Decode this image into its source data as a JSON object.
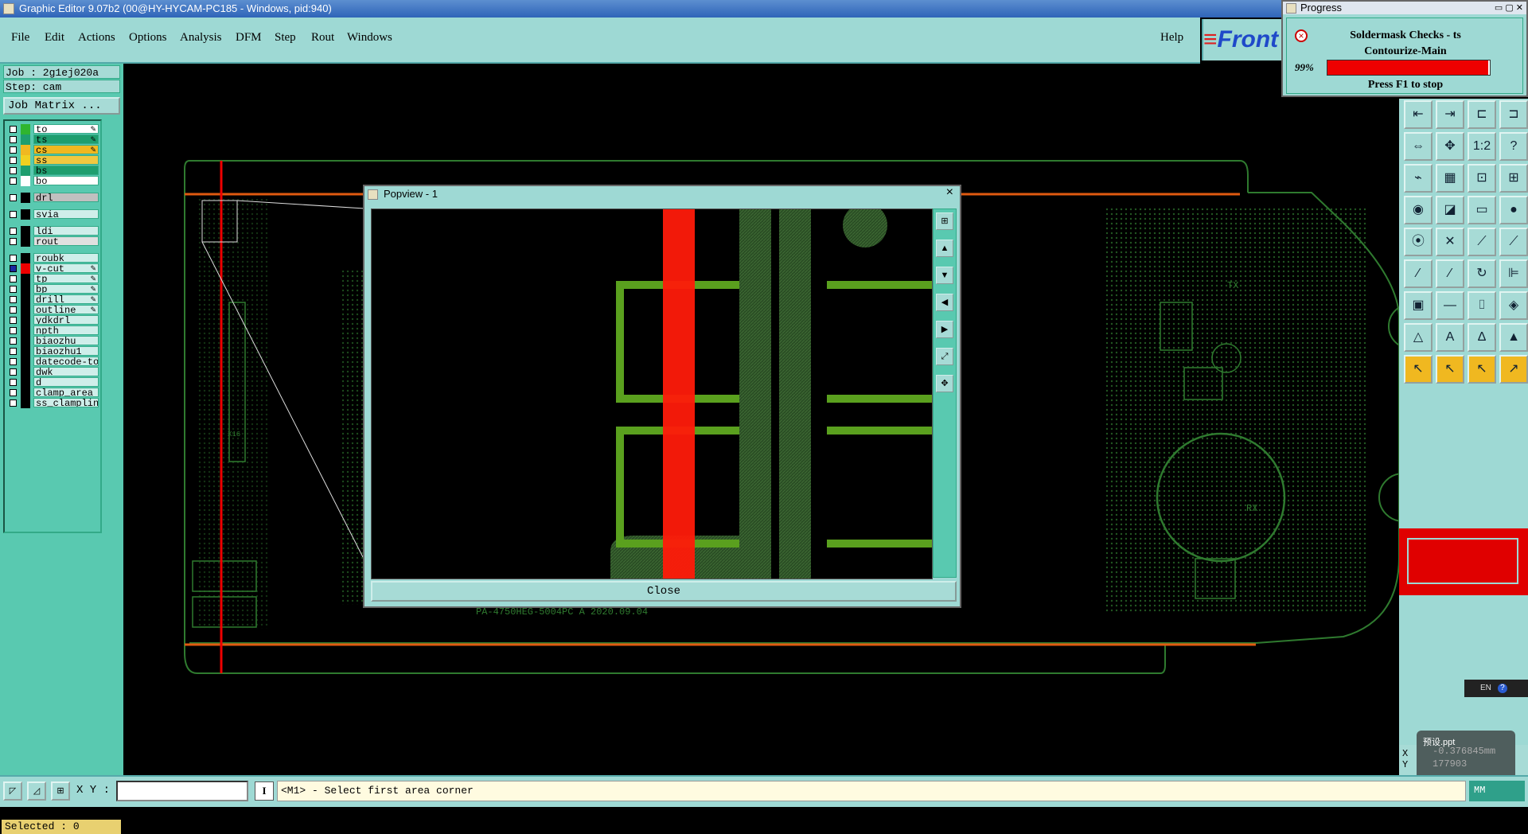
{
  "window": {
    "title": "Graphic Editor 9.07b2 (00@HY-HYCAM-PC185 - Windows, pid:940)"
  },
  "menu": {
    "items": [
      "File",
      "Edit",
      "Actions",
      "Options",
      "Analysis",
      "DFM",
      "Step",
      "Rout",
      "Windows"
    ],
    "help": "Help"
  },
  "logo": {
    "text": "Front"
  },
  "job": {
    "job_label": "Job : 2g1ej020a",
    "step_label": "Step: cam",
    "matrix_button": "Job Matrix ..."
  },
  "layers": [
    {
      "name": "to",
      "color": "#2fb52f",
      "name_bg": "#ffffff",
      "checked": false,
      "edit": true
    },
    {
      "name": "ts",
      "color": "#1e9e6e",
      "name_bg": "#1e9e6e",
      "checked": false,
      "edit": true
    },
    {
      "name": "cs",
      "color": "#f0b820",
      "name_bg": "#f0b820",
      "checked": false,
      "edit": true
    },
    {
      "name": "ss",
      "color": "#f0d020",
      "name_bg": "#f0c840",
      "checked": false,
      "edit": false
    },
    {
      "name": "bs",
      "color": "#1e9e6e",
      "name_bg": "#1e9e6e",
      "checked": false,
      "edit": false
    },
    {
      "name": "bo",
      "color": "#ffffff",
      "name_bg": "#ffffff",
      "checked": false,
      "edit": false
    },
    {
      "name": "drl",
      "color": "#000000",
      "name_bg": "#c0c0c0",
      "checked": false,
      "edit": false
    },
    {
      "name": "svia",
      "color": "#000000",
      "name_bg": "#cfeeea",
      "checked": false,
      "edit": false
    },
    {
      "name": "ldi",
      "color": "#000000",
      "name_bg": "#cfeeea",
      "checked": false,
      "edit": false
    },
    {
      "name": "rout",
      "color": "#000000",
      "name_bg": "#e0e0e0",
      "checked": false,
      "edit": false
    },
    {
      "name": "roubk",
      "color": "#000000",
      "name_bg": "#cfeeea",
      "checked": false,
      "edit": false
    },
    {
      "name": "v-cut",
      "color": "#ee0000",
      "name_bg": "#cfeeea",
      "checked": true,
      "edit": true
    },
    {
      "name": "tp",
      "color": "#000000",
      "name_bg": "#cfeeea",
      "checked": false,
      "edit": true
    },
    {
      "name": "bp",
      "color": "#000000",
      "name_bg": "#cfeeea",
      "checked": false,
      "edit": true
    },
    {
      "name": "drill",
      "color": "#000000",
      "name_bg": "#cfeeea",
      "checked": false,
      "edit": true
    },
    {
      "name": "outline",
      "color": "#000000",
      "name_bg": "#cfeeea",
      "checked": false,
      "edit": true
    },
    {
      "name": "ydkdrl",
      "color": "#000000",
      "name_bg": "#cfeeea",
      "checked": false,
      "edit": false
    },
    {
      "name": "npth",
      "color": "#000000",
      "name_bg": "#cfeeea",
      "checked": false,
      "edit": false
    },
    {
      "name": "biaozhu",
      "color": "#000000",
      "name_bg": "#cfeeea",
      "checked": false,
      "edit": false
    },
    {
      "name": "biaozhu1",
      "color": "#000000",
      "name_bg": "#cfeeea",
      "checked": false,
      "edit": false
    },
    {
      "name": "datecode-to",
      "color": "#000000",
      "name_bg": "#cfeeea",
      "checked": false,
      "edit": false
    },
    {
      "name": "dwk",
      "color": "#000000",
      "name_bg": "#cfeeea",
      "checked": false,
      "edit": false
    },
    {
      "name": "d",
      "color": "#000000",
      "name_bg": "#cfeeea",
      "checked": false,
      "edit": false
    },
    {
      "name": "clamp_area",
      "color": "#000000",
      "name_bg": "#cfeeea",
      "checked": false,
      "edit": false
    },
    {
      "name": "ss_clampline",
      "color": "#000000",
      "name_bg": "#cfeeea",
      "checked": false,
      "edit": false
    }
  ],
  "selected": "Selected : 0",
  "board": {
    "silkscreen_text": "PA-4750HEG-5004PC A     2020.09.04",
    "labels": {
      "tx": "TX",
      "rx": "RX",
      "x16": "X16"
    }
  },
  "popview": {
    "title": "Popview - 1",
    "close_label": "Close",
    "close_x": "×"
  },
  "progress": {
    "title": "Progress",
    "line1": "Soldermask Checks - ts",
    "line2": "Contourize-Main",
    "percent_label": "99%",
    "percent": 99,
    "hint": "Press F1 to stop"
  },
  "status": {
    "xy_label": "X Y :",
    "xy_value": "",
    "message": "<M1> - Select first area corner",
    "unit": "MM"
  },
  "coords": {
    "x": "X",
    "y": "Y"
  },
  "ime": {
    "lang": "EN",
    "help": "?"
  },
  "tray": {
    "file": "预设.ppt",
    "x_value": "-0.376845mm",
    "y_value": "177903"
  },
  "colors": {
    "accent_panel": "#9ed9d4",
    "layer_panel": "#59c9b0",
    "board_green": "#2f7a2f",
    "vcut_red": "#ee0000",
    "route_orange": "#e05a10"
  },
  "icons": {
    "right_toolbar": [
      "zoom-home-icon",
      "zoom-in-icon",
      "zoom-out-icon",
      "fit-icon",
      "pan-icon",
      "center-icon",
      "scale-1-2-icon",
      "help-icon",
      "measure-icon",
      "grid-icon",
      "snap-icon",
      "snap-alt-icon",
      "camera-icon",
      "select-area-icon",
      "ruler-icon",
      "circle-icon",
      "node-icon",
      "cross-icon",
      "line-node-icon",
      "line-node-alt-icon",
      "draw-line-icon",
      "draw-line-alt-icon",
      "arc-icon",
      "feature-icon",
      "pad-icon",
      "minus-icon",
      "mirror-icon",
      "pattern-icon",
      "triangle-icon",
      "triangle-a-icon",
      "triangle-b-icon",
      "triangle-c-icon",
      "pointer-icon",
      "pointer-alt-icon",
      "pointer-b-icon",
      "pointer-multi-icon"
    ],
    "popview_tools": [
      "zoom-window-icon",
      "zoom-up-icon",
      "zoom-down-icon",
      "zoom-left-icon",
      "zoom-right-icon",
      "fit-all-icon",
      "fit-sel-icon"
    ]
  }
}
